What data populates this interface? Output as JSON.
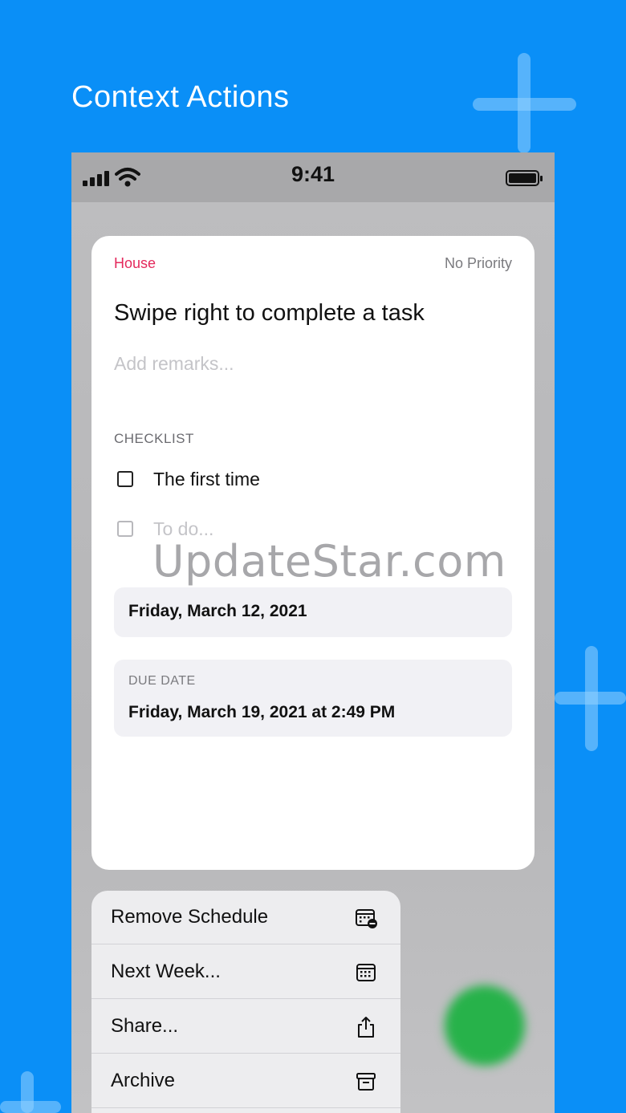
{
  "headline": "Context Actions",
  "status_bar": {
    "time": "9:41"
  },
  "task": {
    "list": "House",
    "priority": "No Priority",
    "title": "Swipe right to complete a task",
    "remarks_placeholder": "Add remarks...",
    "checklist_header": "CHECKLIST",
    "checklist": [
      {
        "label": "The first time",
        "checked": false
      },
      {
        "label": "To do...",
        "placeholder": true
      }
    ],
    "start_date": "Friday, March 12, 2021",
    "due_date_label": "DUE DATE",
    "due_date": "Friday, March 19, 2021 at 2:49 PM"
  },
  "watermark": "UpdateStar.com",
  "context_menu": [
    {
      "label": "Remove Schedule",
      "icon": "calendar-minus-icon"
    },
    {
      "label": "Next Week...",
      "icon": "calendar-icon"
    },
    {
      "label": "Share...",
      "icon": "share-icon"
    },
    {
      "label": "Archive",
      "icon": "archive-icon"
    }
  ],
  "colors": {
    "background": "#0a8ff7",
    "list_accent": "#e4295c",
    "fab": "#27b24a"
  }
}
